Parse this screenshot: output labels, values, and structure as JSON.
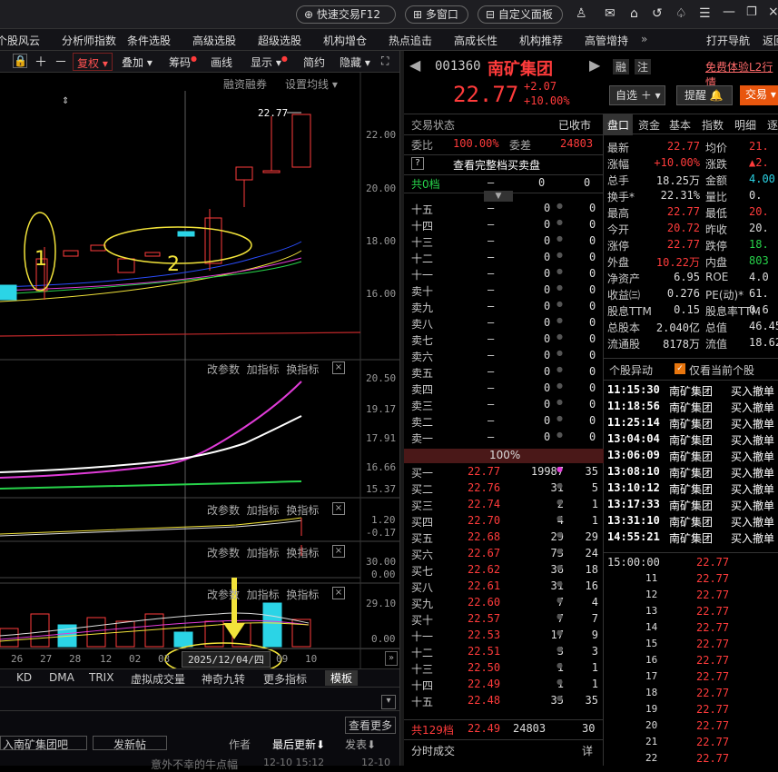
{
  "titlebar": {
    "buttons": [
      "快速交易F12",
      "多窗口",
      "自定义面板"
    ]
  },
  "menu": [
    "个股风云",
    "分析师指数",
    "条件选股",
    "高级选股",
    "超级选股",
    "机构增仓",
    "热点追击",
    "高成长性",
    "机构推荐",
    "高管增持",
    "打开导航",
    "返回"
  ],
  "chart_toolbar": [
    "复权",
    "叠加",
    "筹码",
    "画线",
    "显示",
    "简约",
    "隐藏"
  ],
  "chart_labels": {
    "margin": "融资融券",
    "ma_setting": "设置均线",
    "high_price": "22.77",
    "annot_1": "1",
    "annot_2": "2",
    "sub_actions": [
      "改参数",
      "加指标",
      "换指标"
    ],
    "price_ticks": [
      "22.00",
      "20.00",
      "18.00",
      "16.00"
    ],
    "sub1_ticks": [
      "20.50",
      "19.17",
      "17.91",
      "16.66",
      "15.37"
    ],
    "sub2_ticks": [
      "1.20",
      "-0.17"
    ],
    "sub3_ticks": [
      "30.00",
      "0.00"
    ],
    "sub4_ticks": [
      "29.10",
      "0.00"
    ],
    "x_ticks": [
      "26",
      "27",
      "28",
      "12",
      "02",
      "03",
      "09",
      "10"
    ],
    "date_tip": "2025/12/04/四",
    "bottom_tabs": [
      "KD",
      "DMA",
      "TRIX",
      "虚拟成交量",
      "神奇九转",
      "更多指标",
      "模板"
    ]
  },
  "stock": {
    "code": "001360",
    "name": "南矿集团",
    "price": "22.77",
    "change": "+2.07",
    "change_pct": "+10.00%",
    "tags": [
      "融",
      "注"
    ],
    "l2": "免费体验L2行情",
    "self_select": "自选",
    "remind": "提醒",
    "trade": "交易"
  },
  "trade_status": {
    "label": "交易状态",
    "value": "已收市",
    "wb_label": "委比",
    "wb_value": "100.00%",
    "wc_label": "委差",
    "wc_value": "24803",
    "full": "查看完整档买卖盘",
    "total_sell": "共0档",
    "total_sell_vals": [
      "—",
      "0",
      "0"
    ],
    "pct_bar": "100%",
    "total_buy": "共129档",
    "total_buy_vals": [
      "22.49",
      "24803",
      "30"
    ],
    "timeshare": "分时成交",
    "detail": "详"
  },
  "sell_levels": [
    [
      "十五",
      "—",
      "0",
      "0"
    ],
    [
      "十四",
      "—",
      "0",
      "0"
    ],
    [
      "十三",
      "—",
      "0",
      "0"
    ],
    [
      "十二",
      "—",
      "0",
      "0"
    ],
    [
      "十一",
      "—",
      "0",
      "0"
    ],
    [
      "卖十",
      "—",
      "0",
      "0"
    ],
    [
      "卖九",
      "—",
      "0",
      "0"
    ],
    [
      "卖八",
      "—",
      "0",
      "0"
    ],
    [
      "卖七",
      "—",
      "0",
      "0"
    ],
    [
      "卖六",
      "—",
      "0",
      "0"
    ],
    [
      "卖五",
      "—",
      "0",
      "0"
    ],
    [
      "卖四",
      "—",
      "0",
      "0"
    ],
    [
      "卖三",
      "—",
      "0",
      "0"
    ],
    [
      "卖二",
      "—",
      "0",
      "0"
    ],
    [
      "卖一",
      "—",
      "0",
      "0"
    ]
  ],
  "buy_levels": [
    [
      "买一",
      "22.77",
      "19987",
      "35"
    ],
    [
      "买二",
      "22.76",
      "31",
      "5"
    ],
    [
      "买三",
      "22.74",
      "2",
      "1"
    ],
    [
      "买四",
      "22.70",
      "4",
      "1"
    ],
    [
      "买五",
      "22.68",
      "29",
      "29"
    ],
    [
      "买六",
      "22.67",
      "73",
      "24"
    ],
    [
      "买七",
      "22.62",
      "36",
      "18"
    ],
    [
      "买八",
      "22.61",
      "31",
      "16"
    ],
    [
      "买九",
      "22.60",
      "7",
      "4"
    ],
    [
      "买十",
      "22.57",
      "7",
      "7"
    ],
    [
      "十一",
      "22.53",
      "17",
      "9"
    ],
    [
      "十二",
      "22.51",
      "3",
      "3"
    ],
    [
      "十三",
      "22.50",
      "1",
      "1"
    ],
    [
      "十四",
      "22.49",
      "1",
      "1"
    ],
    [
      "十五",
      "22.48",
      "35",
      "35"
    ]
  ],
  "far_tabs": [
    "盘口",
    "资金",
    "基本",
    "指数",
    "明细",
    "逐"
  ],
  "quote_rows": [
    [
      "最新",
      "22.77",
      "均价",
      "21."
    ],
    [
      "涨幅",
      "+10.00%",
      "涨跌",
      "▲2."
    ],
    [
      "总手",
      "18.25万",
      "金额",
      "4.00"
    ],
    [
      "换手*",
      "22.31%",
      "量比",
      "0."
    ],
    [
      "最高",
      "22.77",
      "最低",
      "20."
    ],
    [
      "今开",
      "20.72",
      "昨收",
      "20."
    ],
    [
      "涨停",
      "22.77",
      "跌停",
      "18."
    ],
    [
      "外盘",
      "10.22万",
      "内盘",
      "803"
    ],
    [
      "净资产",
      "6.95",
      "ROE",
      "4.0"
    ],
    [
      "收益㈢",
      "0.276",
      "PE(动)*",
      "61."
    ],
    [
      "股息TTM",
      "0.15",
      "股息率TTM",
      "0.6"
    ],
    [
      "总股本",
      "2.040亿",
      "总值",
      "46.45"
    ],
    [
      "流通股",
      "8178万",
      "流值",
      "18.62"
    ]
  ],
  "anomaly": {
    "title": "个股异动",
    "check": "仅看当前个股",
    "rows": [
      [
        "11:15:30",
        "南矿集团",
        "买入撤单"
      ],
      [
        "11:18:56",
        "南矿集团",
        "买入撤单"
      ],
      [
        "11:25:14",
        "南矿集团",
        "买入撤单"
      ],
      [
        "13:04:04",
        "南矿集团",
        "买入撤单"
      ],
      [
        "13:06:09",
        "南矿集团",
        "买入撤单"
      ],
      [
        "13:08:10",
        "南矿集团",
        "买入撤单"
      ],
      [
        "13:10:12",
        "南矿集团",
        "买入撤单"
      ],
      [
        "13:17:33",
        "南矿集团",
        "买入撤单"
      ],
      [
        "13:31:10",
        "南矿集团",
        "买入撤单"
      ],
      [
        "14:55:21",
        "南矿集团",
        "买入撤单"
      ]
    ]
  },
  "ticks": [
    [
      "15:00:00",
      "22.77"
    ],
    [
      "11",
      "22.77"
    ],
    [
      "12",
      "22.77"
    ],
    [
      "13",
      "22.77"
    ],
    [
      "14",
      "22.77"
    ],
    [
      "15",
      "22.77"
    ],
    [
      "16",
      "22.77"
    ],
    [
      "17",
      "22.77"
    ],
    [
      "18",
      "22.77"
    ],
    [
      "19",
      "22.77"
    ],
    [
      "20",
      "22.77"
    ],
    [
      "21",
      "22.77"
    ],
    [
      "22",
      "22.77"
    ]
  ],
  "forum": {
    "more": "查看更多",
    "bar": "入南矿集团吧",
    "post": "发新帖",
    "author": "作者",
    "latest": "最后更新",
    "posttime": "发表",
    "row_title": "意外不幸的牛点幅",
    "row_time1": "12-10 15:12",
    "row_time2": "12-10"
  },
  "colors": {
    "up": "#ff3b3b",
    "down": "#27d34a",
    "annot": "#f2e33a",
    "cyan": "#2bd4e6"
  }
}
